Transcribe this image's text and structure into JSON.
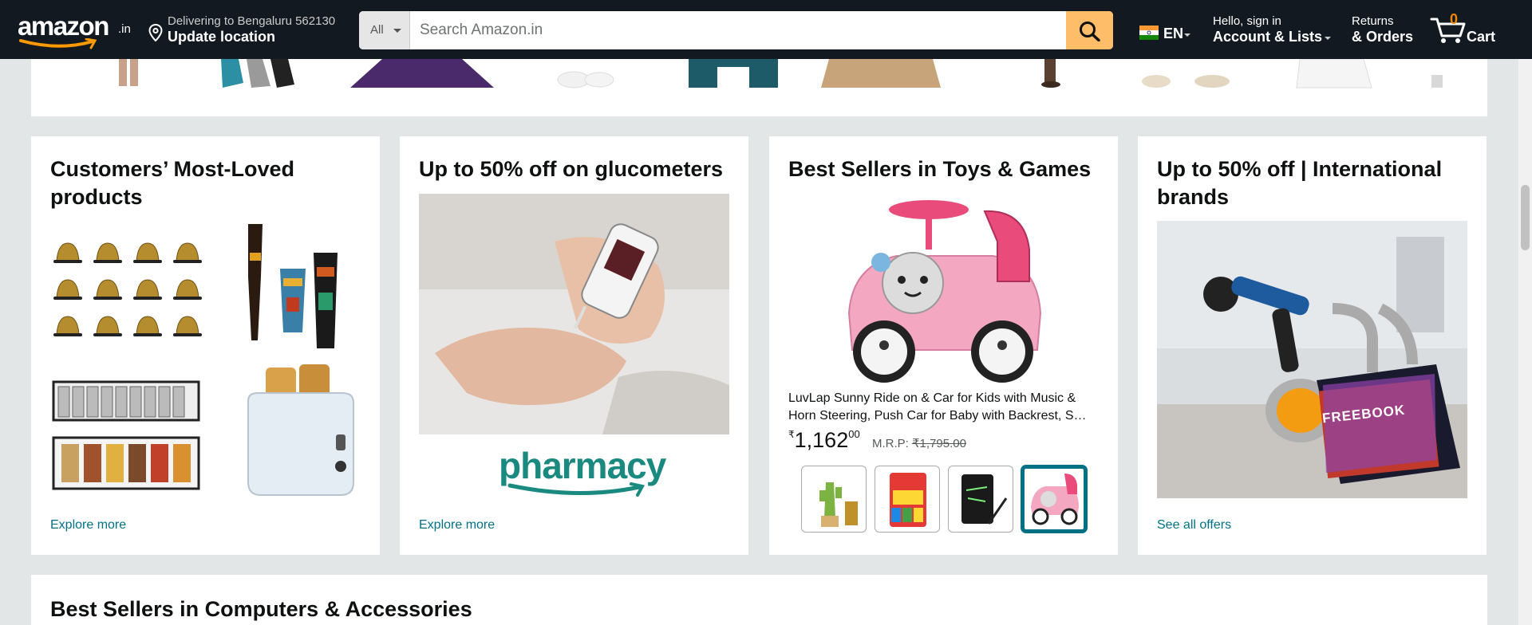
{
  "header": {
    "logo_text": "amazon",
    "logo_tld": ".in",
    "location": {
      "line1": "Delivering to Bengaluru 562130",
      "line2": "Update location"
    },
    "search": {
      "category": "All",
      "placeholder": "Search Amazon.in"
    },
    "language": "EN",
    "account": {
      "line1": "Hello, sign in",
      "line2": "Account & Lists"
    },
    "returns": {
      "line1": "Returns",
      "line2": "& Orders"
    },
    "cart": {
      "count": "0",
      "label": "Cart"
    }
  },
  "cards": [
    {
      "title": "Customers’ Most-Loved products",
      "link": "Explore more"
    },
    {
      "title": "Up to 50% off on glucometers",
      "brand": "pharmacy",
      "link": "Explore more"
    },
    {
      "title": "Best Sellers in Toys & Games",
      "product_title": "LuvLap Sunny Ride on & Car for Kids with Music & Horn Steering, Push Car for Baby with Backrest, S…",
      "price_symbol": "₹",
      "price_whole": "1,162",
      "price_fraction": "00",
      "mrp_label": "M.R.P:",
      "mrp_value": "₹1,795.00"
    },
    {
      "title": "Up to 50% off | International brands",
      "banner_text": "FREEBOOK",
      "link": "See all offers"
    }
  ],
  "bottom_section": {
    "title": "Best Sellers in Computers & Accessories"
  },
  "colors": {
    "nav_bg": "#131921",
    "search_button": "#febd69",
    "link": "#007185",
    "cart_count": "#f08804"
  }
}
